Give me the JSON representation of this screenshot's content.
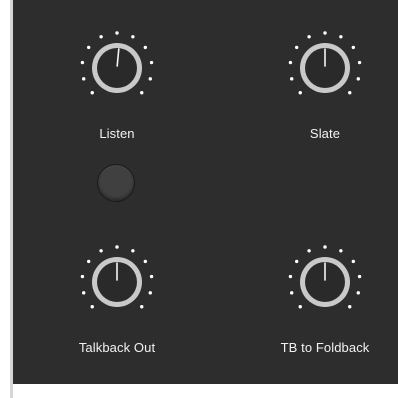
{
  "knobs": [
    {
      "id": "listen",
      "label": "Listen",
      "level": 0.52
    },
    {
      "id": "slate",
      "label": "Slate",
      "level": 0.5
    },
    {
      "id": "talkback-out",
      "label": "Talkback Out",
      "level": 0.5
    },
    {
      "id": "tb-to-foldback",
      "label": "TB to Foldback",
      "level": 0.5
    }
  ],
  "colors": {
    "panel": "#2d2d2d",
    "knob_ring": "#c9c9c9",
    "knob_cap": "#2a2a2a",
    "pointer": "#f5f5f5",
    "dots": "#ffffff",
    "label": "#f2f2f2"
  }
}
